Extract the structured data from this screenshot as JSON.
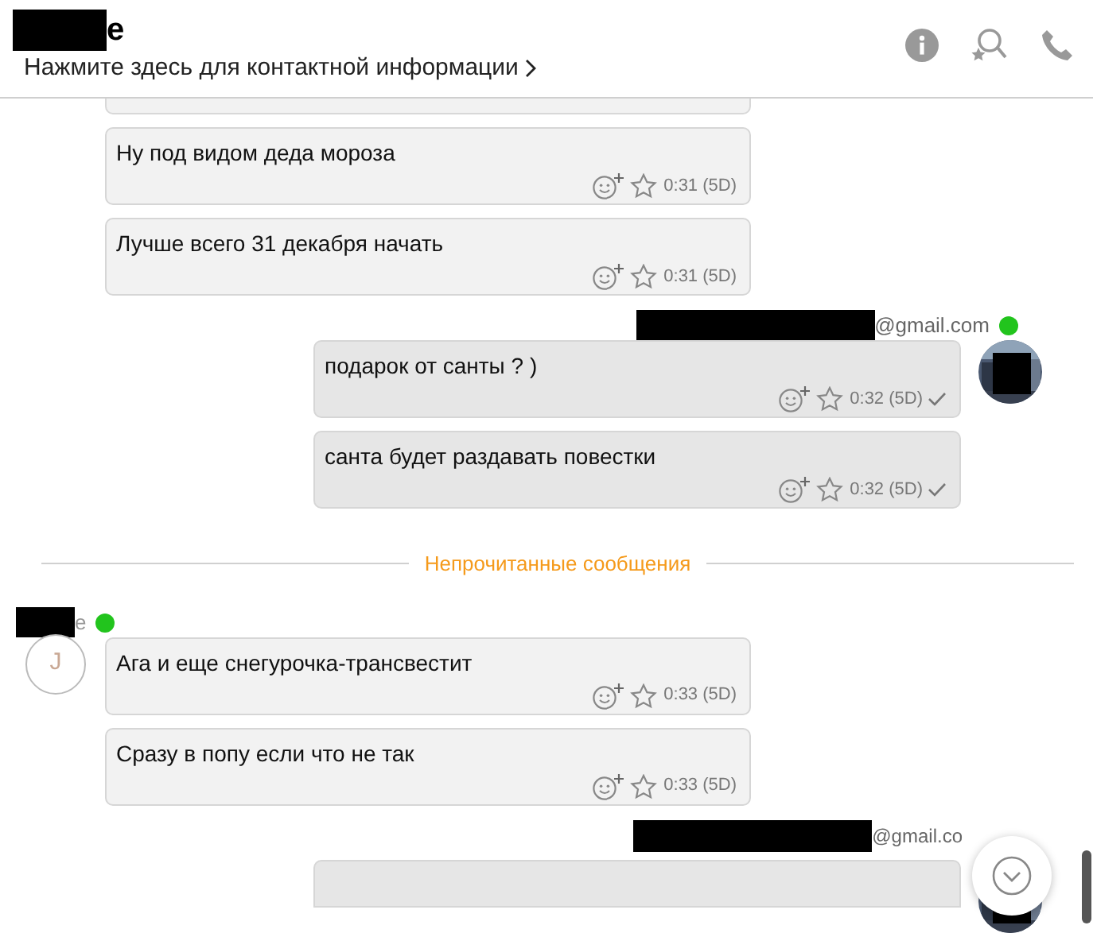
{
  "header": {
    "title": "e",
    "subtitle": "Нажмите здесь для контактной информации"
  },
  "items": [
    {
      "kind": "group",
      "outgoing": false,
      "messages": [
        {
          "text": "Ну под видом деда мороза",
          "time": "0:31 (5D)",
          "delivered": false
        },
        {
          "text": "Лучше всего 31 декабря начать",
          "time": "0:31 (5D)",
          "delivered": false
        }
      ]
    },
    {
      "kind": "group",
      "outgoing": true,
      "sender": "@gmail.com",
      "online": true,
      "messages": [
        {
          "text": "подарок от санты ? )",
          "time": "0:32 (5D)",
          "delivered": true
        },
        {
          "text": "санта будет раздавать повестки",
          "time": "0:32 (5D)",
          "delivered": true
        }
      ]
    },
    {
      "kind": "divider",
      "label": "Непрочитанные сообщения"
    },
    {
      "kind": "group",
      "outgoing": false,
      "sender": "e",
      "online": true,
      "avatar_initial": "J",
      "messages": [
        {
          "text": "Ага и еще снегурочка-трансвестит",
          "time": "0:33 (5D)",
          "delivered": false
        },
        {
          "text": "Сразу в попу если что не так",
          "time": "0:33 (5D)",
          "delivered": false
        }
      ]
    },
    {
      "kind": "group",
      "outgoing": true,
      "sender": "@gmail.co"
    }
  ]
}
